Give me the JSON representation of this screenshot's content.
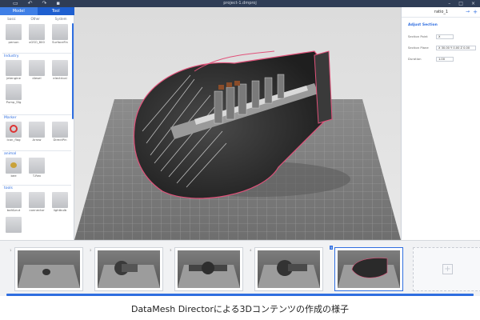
{
  "window": {
    "title": "project-1.dmproj"
  },
  "left_panel": {
    "tabs": [
      "Model",
      "Tool"
    ],
    "subtabs": [
      "basic",
      "Other",
      "System"
    ],
    "sections": [
      {
        "title": "",
        "items": [
          "person",
          "xGSO_800",
          "SurfaceFin"
        ]
      },
      {
        "title": "Industry",
        "items": [
          "jetengine",
          "diesel",
          "electrical",
          "Pump_Sfg"
        ]
      },
      {
        "title": "Marker",
        "items": [
          "Icon_flag",
          "Arrow",
          "DirectPin"
        ]
      },
      {
        "title": "animal",
        "items": [
          "bee",
          "T-Rex"
        ]
      },
      {
        "title": "tools",
        "items": [
          "bolt&nut",
          "connector",
          "lightbulb",
          ""
        ]
      }
    ]
  },
  "right_panel": {
    "title": "ratio_1",
    "section": "Adjust Section",
    "rows": [
      {
        "label": "Section Point",
        "value": "X"
      },
      {
        "label": "Section Plane",
        "value": "X 30.00  Y 0.00  Z 0.00"
      },
      {
        "label": "Duration",
        "value": "1.00"
      }
    ]
  },
  "timeline": {
    "frames": [
      "1",
      "2",
      "3",
      "4",
      "5"
    ],
    "active_index": 4
  },
  "caption": "DataMesh Directorによる3Dコンテンツの作成の様子",
  "colors": {
    "accent": "#2f6ee0",
    "titlebar": "#2f3d56",
    "highlight": "#e0527a"
  }
}
